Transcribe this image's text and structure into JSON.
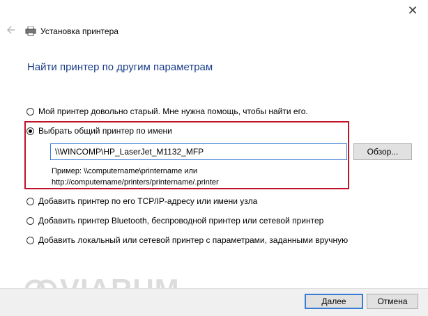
{
  "window": {
    "title": "Установка принтера",
    "close_glyph": "✕"
  },
  "heading": "Найти принтер по другим параметрам",
  "options": [
    {
      "label": "Мой принтер довольно старый. Мне нужна помощь, чтобы найти его.",
      "checked": false
    },
    {
      "label": "Выбрать общий принтер по имени",
      "checked": true
    },
    {
      "label": "Добавить принтер по его TCP/IP-адресу или имени узла",
      "checked": false
    },
    {
      "label": "Добавить принтер Bluetooth, беспроводной принтер или сетевой принтер",
      "checked": false
    },
    {
      "label": "Добавить локальный или сетевой принтер с параметрами, заданными вручную",
      "checked": false
    }
  ],
  "shared_printer": {
    "value": "\\\\WINCOMP\\HP_LaserJet_M1132_MFP",
    "browse_label": "Обзор...",
    "example_line1": "Пример: \\\\computername\\printername или",
    "example_line2": "http://computername/printers/printername/.printer"
  },
  "footer": {
    "next_label": "Далее",
    "cancel_label": "Отмена"
  },
  "watermark": {
    "text": "VIARUM"
  },
  "colors": {
    "heading": "#1a3e8a",
    "highlight": "#c1122b",
    "focus": "#3a7bd5"
  }
}
